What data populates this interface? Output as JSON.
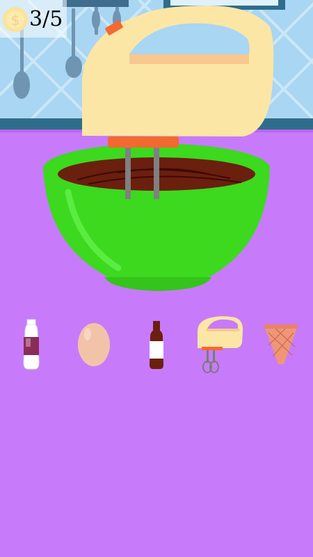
{
  "hud": {
    "score_text": "3/5",
    "coin_icon": "dollar-coin-icon"
  },
  "colors": {
    "background": "#c77bfa",
    "wall": "#a9d6f2",
    "wall_trim": "#2f6d8c",
    "bowl": "#3cd91f",
    "batter": "#6b1f0e",
    "mixer_body": "#fbe6a6",
    "mixer_accent": "#f36a30",
    "coin": "#f9c21b"
  },
  "tray": {
    "items": [
      {
        "name": "milk-bottle",
        "icon": "milk-bottle-icon"
      },
      {
        "name": "egg",
        "icon": "egg-icon"
      },
      {
        "name": "vanilla-bottle",
        "icon": "vanilla-bottle-icon"
      },
      {
        "name": "hand-mixer",
        "icon": "hand-mixer-icon"
      },
      {
        "name": "waffle-cone",
        "icon": "waffle-cone-icon"
      }
    ]
  }
}
